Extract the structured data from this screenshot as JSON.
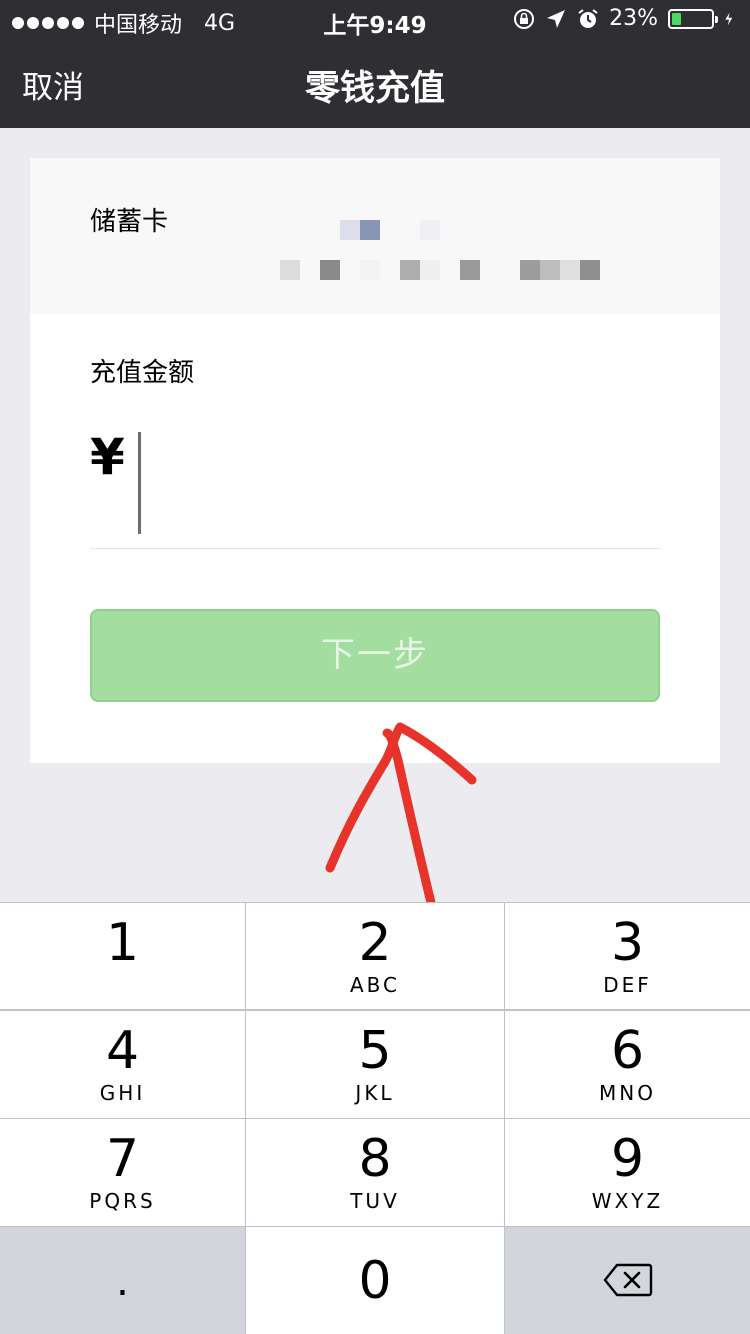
{
  "status_bar": {
    "carrier": "中国移动",
    "network": "4G",
    "time": "上午9:49",
    "battery_percent": "23%",
    "battery_level": 0.23,
    "icons": [
      "rotation-lock-icon",
      "location-icon",
      "alarm-icon",
      "charging-icon"
    ]
  },
  "nav": {
    "cancel_label": "取消",
    "title": "零钱充值"
  },
  "card": {
    "bank_card_label": "储蓄卡",
    "amount_label": "充值金额",
    "currency_symbol": "¥",
    "amount_value": "",
    "next_button_label": "下一步",
    "next_button_color": "#a3dea0"
  },
  "keypad": {
    "keys": [
      {
        "digit": "1",
        "letters": ""
      },
      {
        "digit": "2",
        "letters": "ABC"
      },
      {
        "digit": "3",
        "letters": "DEF"
      },
      {
        "digit": "4",
        "letters": "GHI"
      },
      {
        "digit": "5",
        "letters": "JKL"
      },
      {
        "digit": "6",
        "letters": "MNO"
      },
      {
        "digit": "7",
        "letters": "PQRS"
      },
      {
        "digit": "8",
        "letters": "TUV"
      },
      {
        "digit": "9",
        "letters": "WXYZ"
      }
    ],
    "decimal_label": ".",
    "zero_label": "0",
    "delete_icon": "backspace-icon"
  },
  "annotation": {
    "color": "#e8332b",
    "icon": "hand-drawn-arrow"
  }
}
